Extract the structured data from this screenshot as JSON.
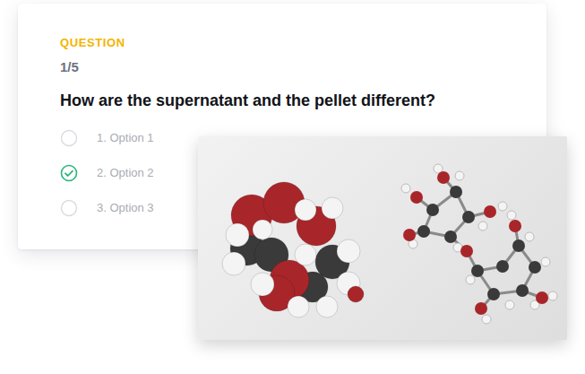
{
  "quiz": {
    "label": "QUESTION",
    "progress": "1/5",
    "question": "How are the supernatant and the pellet different?",
    "options": [
      {
        "label": "1. Option 1",
        "selected": false
      },
      {
        "label": "2. Option 2",
        "selected": true
      },
      {
        "label": "3. Option 3",
        "selected": false
      }
    ]
  }
}
